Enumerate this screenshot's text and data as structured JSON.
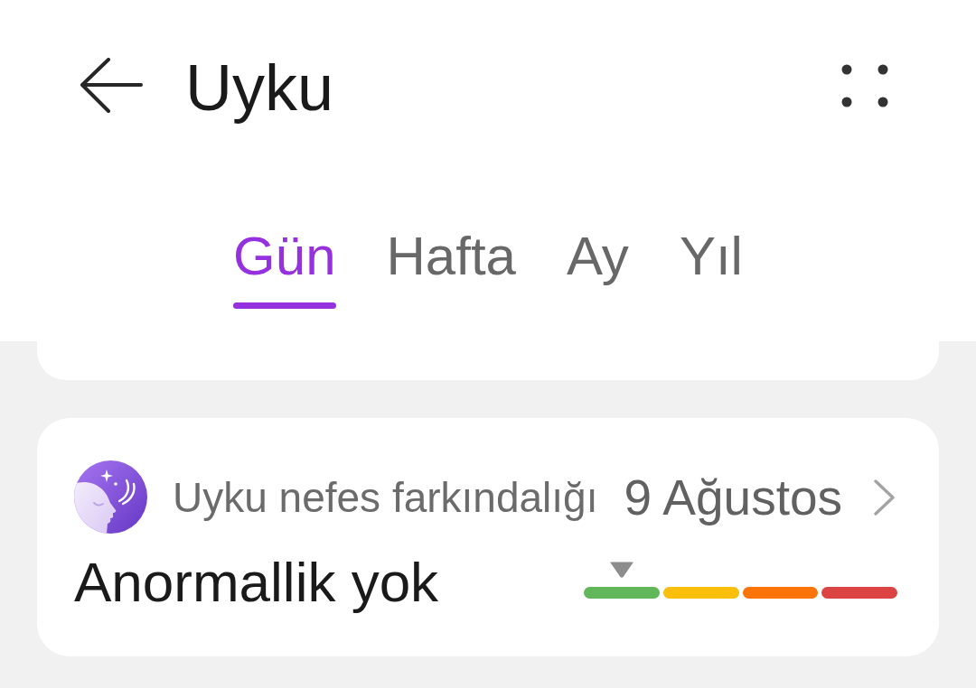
{
  "header": {
    "title": "Uyku"
  },
  "tabs": [
    {
      "label": "Gün",
      "selected": true
    },
    {
      "label": "Hafta",
      "selected": false
    },
    {
      "label": "Ay",
      "selected": false
    },
    {
      "label": "Yıl",
      "selected": false
    }
  ],
  "breathing_card": {
    "title": "Uyku nefes farkındalığı",
    "date": "9 Ağustos",
    "status": "Anormallik yok",
    "scale": {
      "segments": [
        {
          "color": "#62b75a",
          "selected": true
        },
        {
          "color": "#f9bf0a",
          "selected": false
        },
        {
          "color": "#fc7408",
          "selected": false
        },
        {
          "color": "#dc4343",
          "selected": false
        }
      ]
    }
  }
}
